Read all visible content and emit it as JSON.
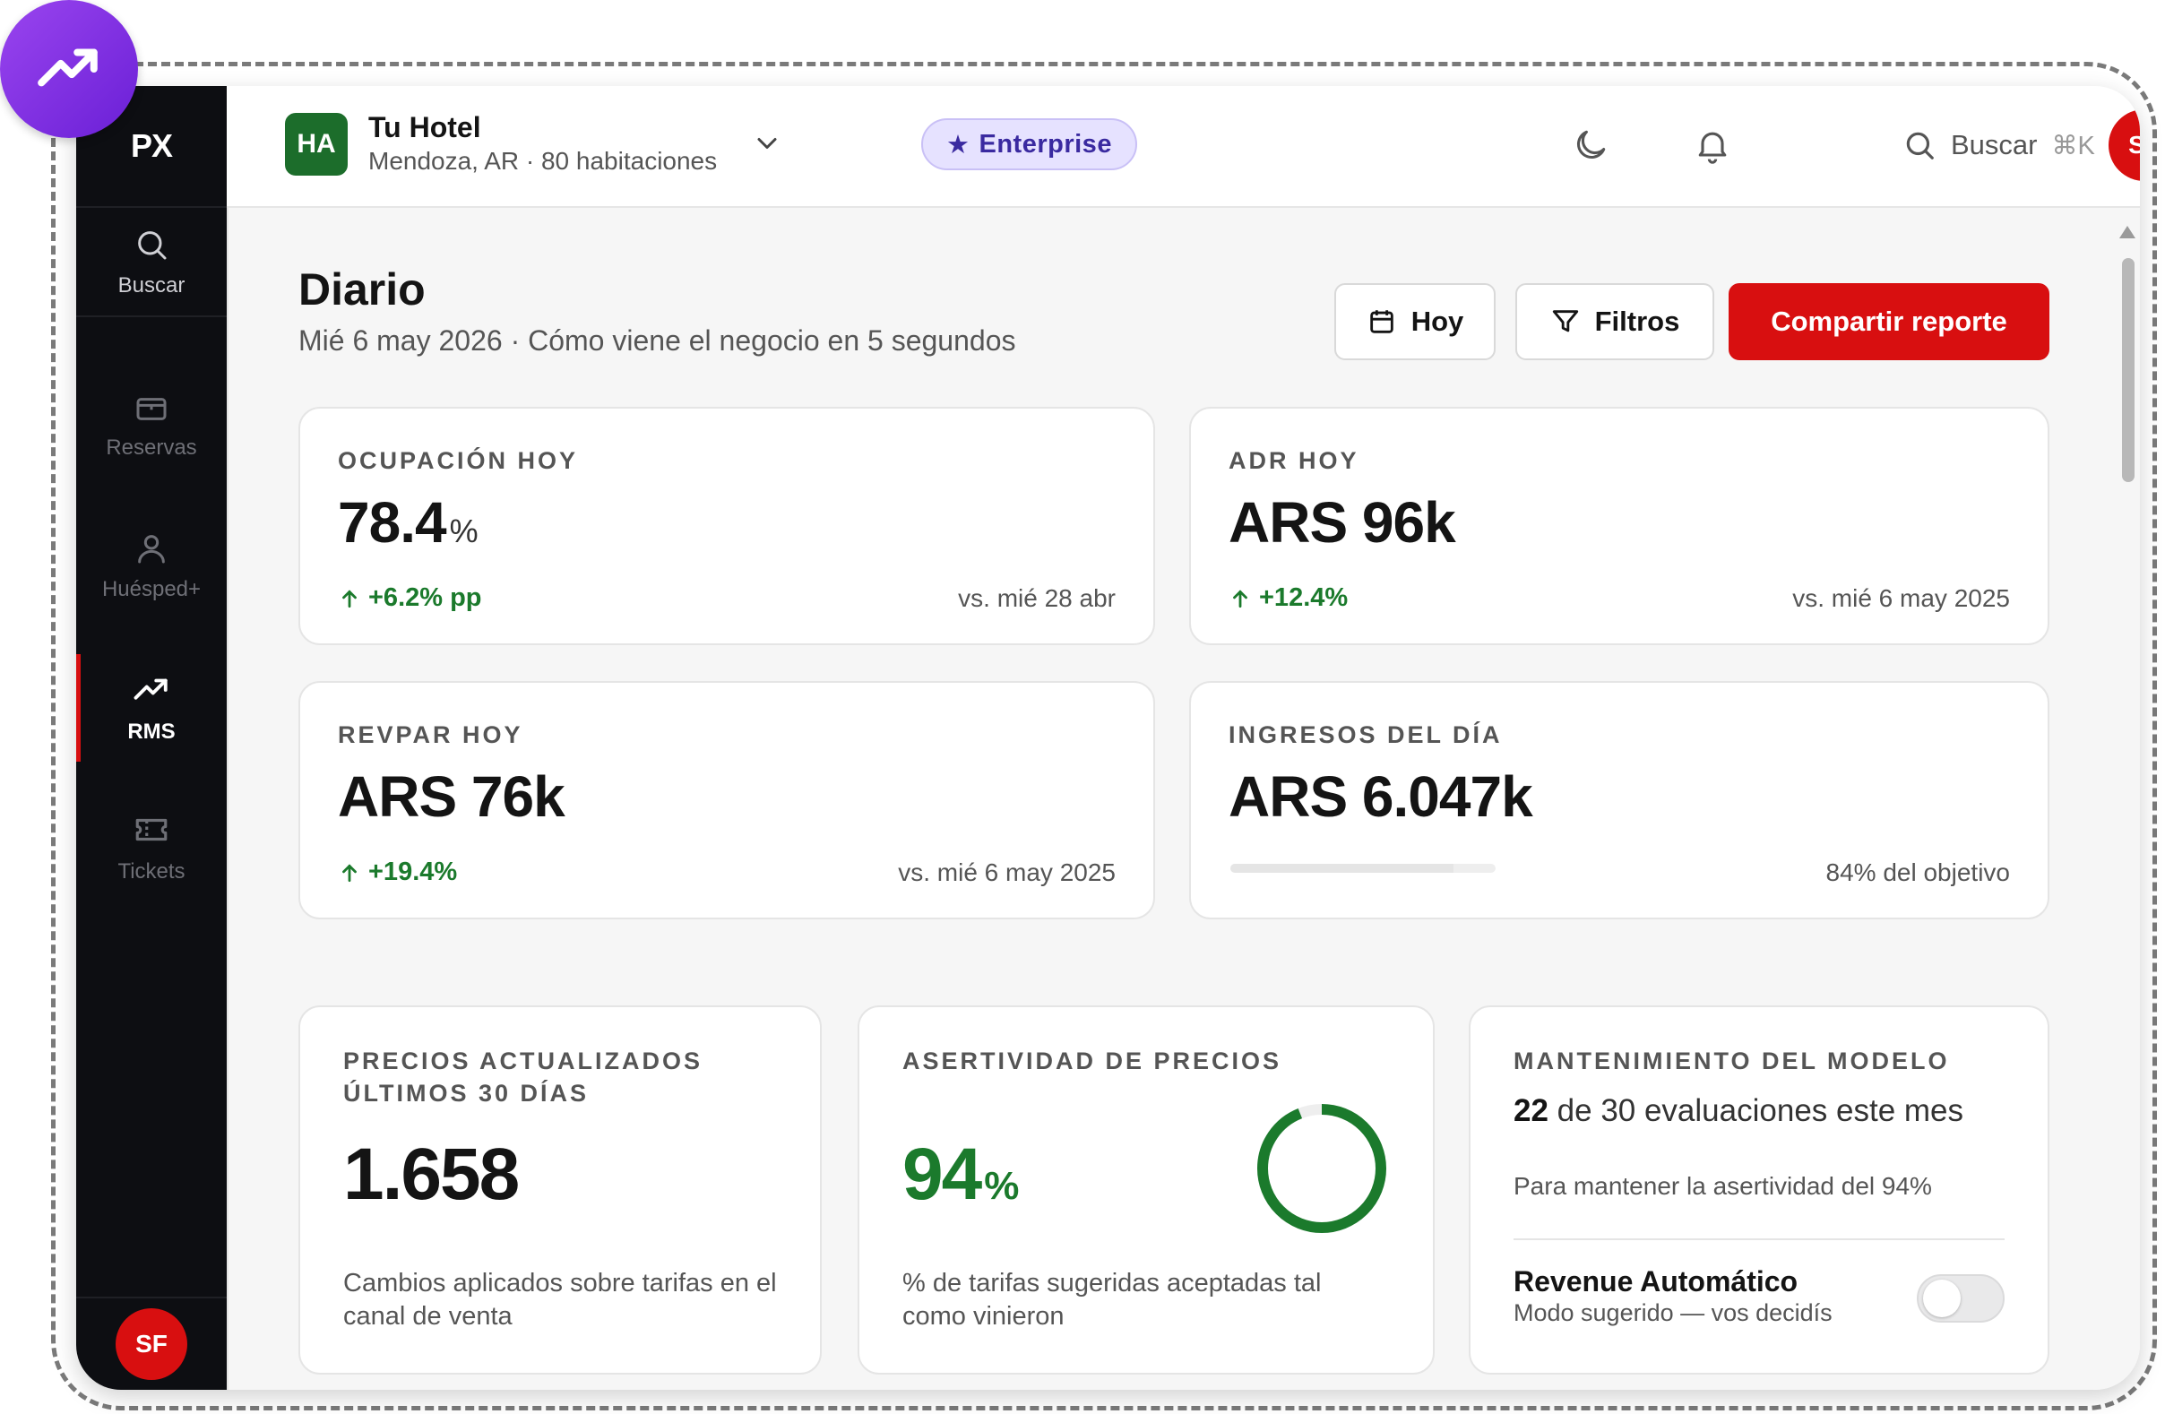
{
  "sidebar": {
    "logo": "PX",
    "items": [
      {
        "label": "Buscar",
        "icon": "search-icon"
      },
      {
        "label": "Reservas",
        "icon": "briefcase-icon"
      },
      {
        "label": "Huésped+",
        "icon": "user-icon"
      },
      {
        "label": "RMS",
        "icon": "trending-up-icon",
        "active": true
      },
      {
        "label": "Tickets",
        "icon": "ticket-icon"
      }
    ],
    "user_initials": "SF"
  },
  "header": {
    "hotel_initials": "HA",
    "hotel_name": "Tu Hotel",
    "hotel_meta": "Mendoza, AR · 80 habitaciones",
    "plan": "Enterprise",
    "search_label": "Buscar",
    "search_shortcut": "⌘K",
    "user_initials": "SF"
  },
  "page": {
    "title": "Diario",
    "subtitle": "Mié 6 may 2026 · Cómo viene el negocio en 5 segundos",
    "actions": {
      "today": "Hoy",
      "filters": "Filtros",
      "share": "Compartir reporte"
    }
  },
  "kpis": {
    "occupancy": {
      "label": "OCUPACIÓN HOY",
      "value": "78.4",
      "unit": "%",
      "delta": "+6.2% pp",
      "compare": "vs. mié 28 abr"
    },
    "adr": {
      "label": "ADR HOY",
      "value": "ARS 96k",
      "delta": "+12.4%",
      "compare": "vs. mié 6 may 2025"
    },
    "revpar": {
      "label": "REVPAR HOY",
      "value": "ARS 76k",
      "delta": "+19.4%",
      "compare": "vs. mié 6 may 2025"
    },
    "revenue": {
      "label": "INGRESOS DEL DÍA",
      "value": "ARS 6.047k",
      "goal_text": "84% del objetivo",
      "goal_fraction": 0.84
    }
  },
  "prices_updated": {
    "label_line1": "PRECIOS ACTUALIZADOS",
    "label_line2": "ÚLTIMOS 30 DÍAS",
    "value": "1.658",
    "description": "Cambios aplicados sobre tarifas en el canal de venta"
  },
  "accuracy": {
    "label": "ASERTIVIDAD DE PRECIOS",
    "value": "94",
    "unit": "%",
    "fraction": 0.94,
    "description": "% de tarifas sugeridas aceptadas tal como vinieron",
    "color": "#1b7a2c"
  },
  "maintenance": {
    "label": "MANTENIMIENTO DEL MODELO",
    "done": "22",
    "rest": " de 30 evaluaciones este mes",
    "subtitle": "Para mantener la asertividad del 94%",
    "auto_title": "Revenue Automático",
    "auto_sub": "Modo sugerido — vos decidís",
    "auto_enabled": false
  },
  "colors": {
    "brand_red": "#d80f10",
    "positive_green": "#1b7a2c",
    "sidebar_bg": "#0d0e12",
    "accent_purple": "#6a1fd6"
  }
}
